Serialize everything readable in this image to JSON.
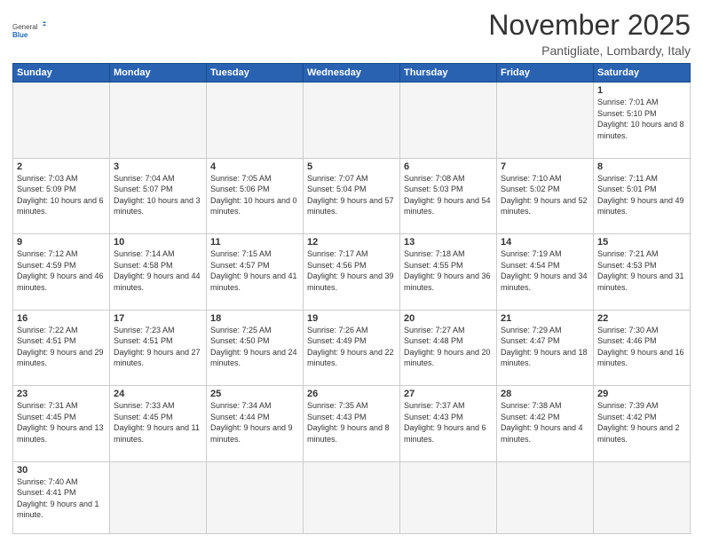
{
  "logo": {
    "general": "General",
    "blue": "Blue"
  },
  "title": "November 2025",
  "subtitle": "Pantigliate, Lombardy, Italy",
  "days_of_week": [
    "Sunday",
    "Monday",
    "Tuesday",
    "Wednesday",
    "Thursday",
    "Friday",
    "Saturday"
  ],
  "weeks": [
    [
      {
        "day": "",
        "info": ""
      },
      {
        "day": "",
        "info": ""
      },
      {
        "day": "",
        "info": ""
      },
      {
        "day": "",
        "info": ""
      },
      {
        "day": "",
        "info": ""
      },
      {
        "day": "",
        "info": ""
      },
      {
        "day": "1",
        "info": "Sunrise: 7:01 AM\nSunset: 5:10 PM\nDaylight: 10 hours and 8 minutes."
      }
    ],
    [
      {
        "day": "2",
        "info": "Sunrise: 7:03 AM\nSunset: 5:09 PM\nDaylight: 10 hours and 6 minutes."
      },
      {
        "day": "3",
        "info": "Sunrise: 7:04 AM\nSunset: 5:07 PM\nDaylight: 10 hours and 3 minutes."
      },
      {
        "day": "4",
        "info": "Sunrise: 7:05 AM\nSunset: 5:06 PM\nDaylight: 10 hours and 0 minutes."
      },
      {
        "day": "5",
        "info": "Sunrise: 7:07 AM\nSunset: 5:04 PM\nDaylight: 9 hours and 57 minutes."
      },
      {
        "day": "6",
        "info": "Sunrise: 7:08 AM\nSunset: 5:03 PM\nDaylight: 9 hours and 54 minutes."
      },
      {
        "day": "7",
        "info": "Sunrise: 7:10 AM\nSunset: 5:02 PM\nDaylight: 9 hours and 52 minutes."
      },
      {
        "day": "8",
        "info": "Sunrise: 7:11 AM\nSunset: 5:01 PM\nDaylight: 9 hours and 49 minutes."
      }
    ],
    [
      {
        "day": "9",
        "info": "Sunrise: 7:12 AM\nSunset: 4:59 PM\nDaylight: 9 hours and 46 minutes."
      },
      {
        "day": "10",
        "info": "Sunrise: 7:14 AM\nSunset: 4:58 PM\nDaylight: 9 hours and 44 minutes."
      },
      {
        "day": "11",
        "info": "Sunrise: 7:15 AM\nSunset: 4:57 PM\nDaylight: 9 hours and 41 minutes."
      },
      {
        "day": "12",
        "info": "Sunrise: 7:17 AM\nSunset: 4:56 PM\nDaylight: 9 hours and 39 minutes."
      },
      {
        "day": "13",
        "info": "Sunrise: 7:18 AM\nSunset: 4:55 PM\nDaylight: 9 hours and 36 minutes."
      },
      {
        "day": "14",
        "info": "Sunrise: 7:19 AM\nSunset: 4:54 PM\nDaylight: 9 hours and 34 minutes."
      },
      {
        "day": "15",
        "info": "Sunrise: 7:21 AM\nSunset: 4:53 PM\nDaylight: 9 hours and 31 minutes."
      }
    ],
    [
      {
        "day": "16",
        "info": "Sunrise: 7:22 AM\nSunset: 4:51 PM\nDaylight: 9 hours and 29 minutes."
      },
      {
        "day": "17",
        "info": "Sunrise: 7:23 AM\nSunset: 4:51 PM\nDaylight: 9 hours and 27 minutes."
      },
      {
        "day": "18",
        "info": "Sunrise: 7:25 AM\nSunset: 4:50 PM\nDaylight: 9 hours and 24 minutes."
      },
      {
        "day": "19",
        "info": "Sunrise: 7:26 AM\nSunset: 4:49 PM\nDaylight: 9 hours and 22 minutes."
      },
      {
        "day": "20",
        "info": "Sunrise: 7:27 AM\nSunset: 4:48 PM\nDaylight: 9 hours and 20 minutes."
      },
      {
        "day": "21",
        "info": "Sunrise: 7:29 AM\nSunset: 4:47 PM\nDaylight: 9 hours and 18 minutes."
      },
      {
        "day": "22",
        "info": "Sunrise: 7:30 AM\nSunset: 4:46 PM\nDaylight: 9 hours and 16 minutes."
      }
    ],
    [
      {
        "day": "23",
        "info": "Sunrise: 7:31 AM\nSunset: 4:45 PM\nDaylight: 9 hours and 13 minutes."
      },
      {
        "day": "24",
        "info": "Sunrise: 7:33 AM\nSunset: 4:45 PM\nDaylight: 9 hours and 11 minutes."
      },
      {
        "day": "25",
        "info": "Sunrise: 7:34 AM\nSunset: 4:44 PM\nDaylight: 9 hours and 9 minutes."
      },
      {
        "day": "26",
        "info": "Sunrise: 7:35 AM\nSunset: 4:43 PM\nDaylight: 9 hours and 8 minutes."
      },
      {
        "day": "27",
        "info": "Sunrise: 7:37 AM\nSunset: 4:43 PM\nDaylight: 9 hours and 6 minutes."
      },
      {
        "day": "28",
        "info": "Sunrise: 7:38 AM\nSunset: 4:42 PM\nDaylight: 9 hours and 4 minutes."
      },
      {
        "day": "29",
        "info": "Sunrise: 7:39 AM\nSunset: 4:42 PM\nDaylight: 9 hours and 2 minutes."
      }
    ],
    [
      {
        "day": "30",
        "info": "Sunrise: 7:40 AM\nSunset: 4:41 PM\nDaylight: 9 hours and 1 minute."
      },
      {
        "day": "",
        "info": ""
      },
      {
        "day": "",
        "info": ""
      },
      {
        "day": "",
        "info": ""
      },
      {
        "day": "",
        "info": ""
      },
      {
        "day": "",
        "info": ""
      },
      {
        "day": "",
        "info": ""
      }
    ]
  ]
}
